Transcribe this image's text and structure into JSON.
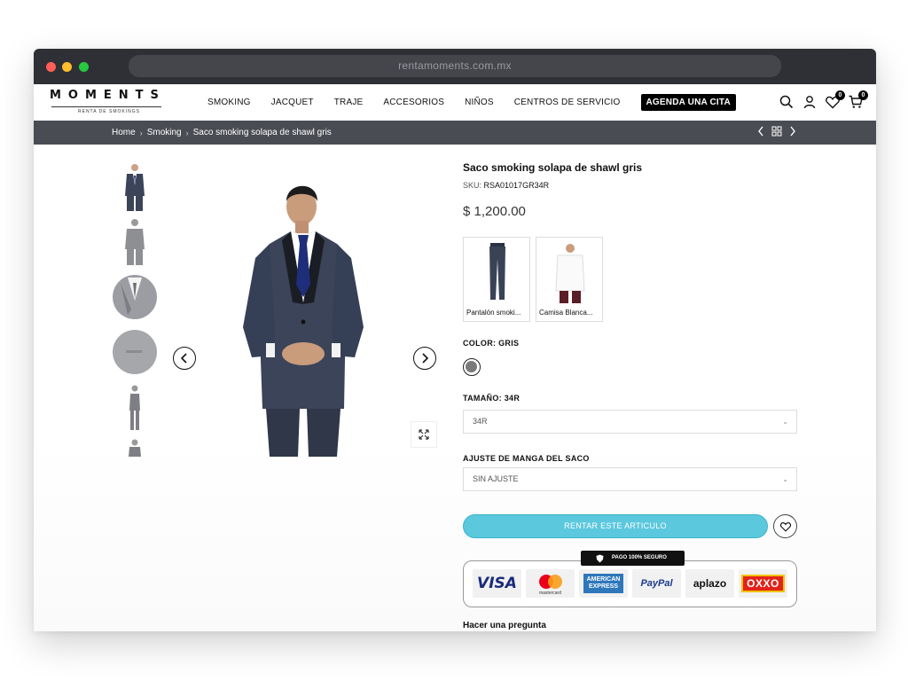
{
  "browser": {
    "url": "rentamoments.com.mx"
  },
  "header": {
    "logo_text": "MOMENTS",
    "logo_subtitle": "RENTA DE SMOKINGS",
    "nav": [
      "SMOKING",
      "JACQUET",
      "TRAJE",
      "ACCESORIOS",
      "NIÑOS",
      "CENTROS DE SERVICIO"
    ],
    "cta_label": "AGENDA UNA CITA",
    "wishlist_count": "0",
    "cart_count": "0"
  },
  "breadcrumb": {
    "items": [
      "Home",
      "Smoking",
      "Saco smoking solapa de shawl gris"
    ]
  },
  "product": {
    "title": "Saco smoking solapa de shawl gris",
    "sku_label": "SKU:",
    "sku": "RSA01017GR34R",
    "price": "$ 1,200.00",
    "bundle": [
      {
        "label": "Pantalón smoki..."
      },
      {
        "label": "Camisa Blanca..."
      }
    ],
    "color_label": "COLOR: GRIS",
    "color_swatch": "#7a7a7a",
    "size_label": "TAMAÑO: 34R",
    "size_value": "34R",
    "sleeve_label": "AJUSTE DE MANGA DEL SACO",
    "sleeve_value": "SIN AJUSTE",
    "rent_button": "RENTAR ESTE ARTICULO",
    "secure_badge": "PAGO 100% SEGURO",
    "payment_methods": [
      "VISA",
      "mastercard",
      "AMERICAN EXPRESS",
      "PayPal",
      "aplazo",
      "OXXO"
    ],
    "ask_question": "Hacer una pregunta"
  },
  "colors": {
    "accent": "#5bc8de",
    "crumb_bar": "#4a4c53",
    "titlebar": "#2f3035",
    "suit": "#3b4458"
  }
}
